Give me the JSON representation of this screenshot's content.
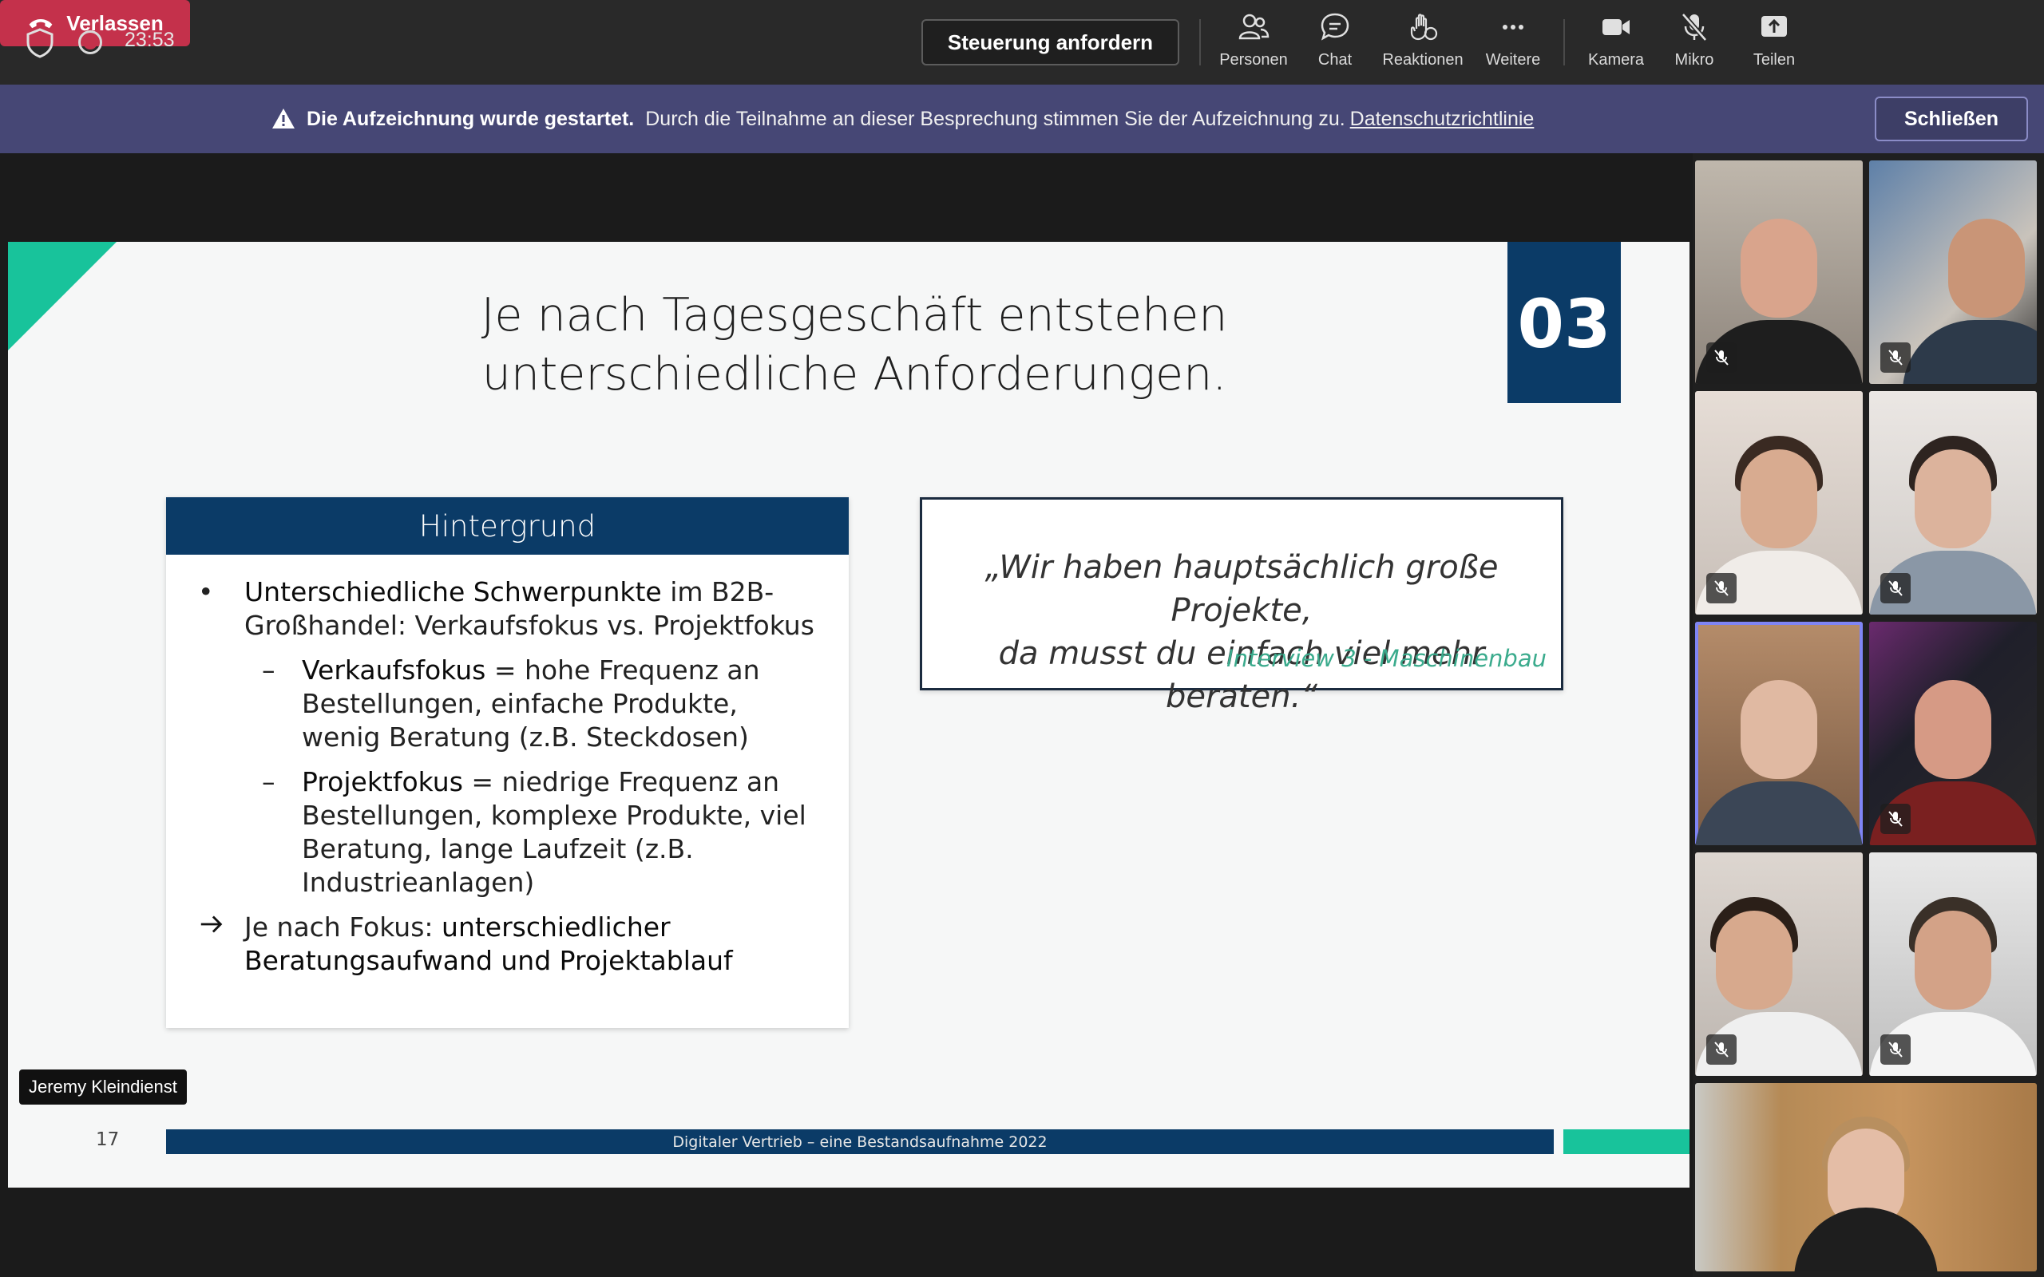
{
  "topbar": {
    "timer": "23:53",
    "request_control": "Steuerung anfordern",
    "buttons": {
      "people": "Personen",
      "chat": "Chat",
      "reactions": "Reaktionen",
      "more": "Weitere",
      "camera": "Kamera",
      "mic": "Mikro",
      "share": "Teilen"
    },
    "leave": "Verlassen"
  },
  "banner": {
    "title": "Die Aufzeichnung wurde gestartet.",
    "message": "Durch die Teilnahme an dieser Besprechung stimmen Sie der Aufzeichnung zu.",
    "link": "Datenschutzrichtlinie",
    "close": "Schließen"
  },
  "slide": {
    "title_line1": "Je nach Tagesgeschäft entstehen",
    "title_line2": "unterschiedliche Anforderungen.",
    "section_number": "03",
    "card": {
      "header": "Hintergrund",
      "bullet1_strong": "Unterschiedliche Schwerpunkte",
      "bullet1_rest": " im B2B-Großhandel: Verkaufsfokus vs. Projektfokus",
      "sub1_strong": "Verkaufsfokus",
      "sub1_rest": " = hohe Frequenz an Bestellungen, einfache Produkte, wenig Beratung (z.B. Steckdosen)",
      "sub2_strong": "Projektfokus",
      "sub2_rest": " = niedrige Frequenz an Bestellungen, komplexe Produkte, viel Beratung, lange Laufzeit (z.B. Industrieanlagen)",
      "arrow_plain": "Je nach Fokus: ",
      "arrow_strong": "unterschiedlicher Beratungsaufwand und Projektablauf"
    },
    "quote": {
      "line1": "„Wir haben hauptsächlich große Projekte,",
      "line2": "da musst du einfach viel mehr beraten.“",
      "source": "Interview 3 - Maschinenbau"
    },
    "page_number": "17",
    "footer": "Digitaler Vertrieb – eine Bestandsaufnahme 2022"
  },
  "presenter": {
    "name": "Jeremy Kleindienst"
  },
  "colors": {
    "topbar": "#292929",
    "banner": "#464775",
    "leave": "#c4314b",
    "slide_navy": "#0b3b67",
    "slide_teal": "#18c39b",
    "active_speaker": "#7f85f5"
  }
}
